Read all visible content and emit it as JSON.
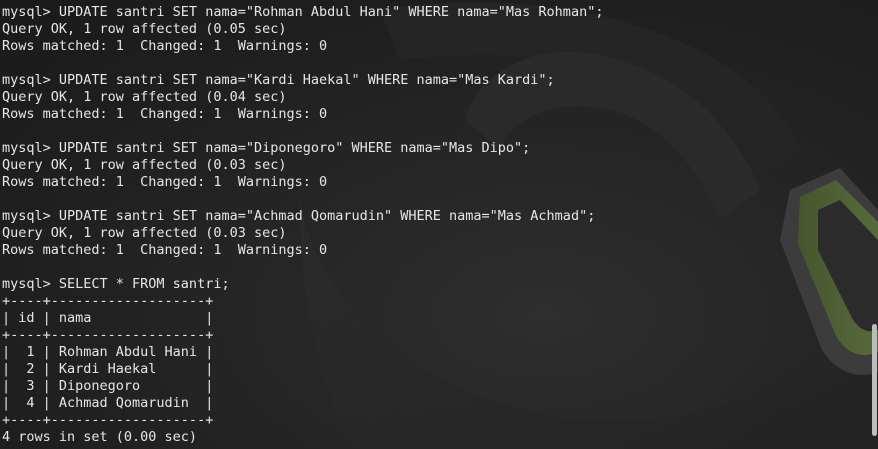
{
  "terminal": {
    "lines": [
      "mysql> UPDATE santri SET nama=\"Rohman Abdul Hani\" WHERE nama=\"Mas Rohman\";",
      "Query OK, 1 row affected (0.05 sec)",
      "Rows matched: 1  Changed: 1  Warnings: 0",
      "",
      "mysql> UPDATE santri SET nama=\"Kardi Haekal\" WHERE nama=\"Mas Kardi\";",
      "Query OK, 1 row affected (0.04 sec)",
      "Rows matched: 1  Changed: 1  Warnings: 0",
      "",
      "mysql> UPDATE santri SET nama=\"Diponegoro\" WHERE nama=\"Mas Dipo\";",
      "Query OK, 1 row affected (0.03 sec)",
      "Rows matched: 1  Changed: 1  Warnings: 0",
      "",
      "mysql> UPDATE santri SET nama=\"Achmad Qomarudin\" WHERE nama=\"Mas Achmad\";",
      "Query OK, 1 row affected (0.03 sec)",
      "Rows matched: 1  Changed: 1  Warnings: 0",
      "",
      "mysql> SELECT * FROM santri;",
      "+----+-------------------+",
      "| id | nama              |",
      "+----+-------------------+",
      "|  1 | Rohman Abdul Hani |",
      "|  2 | Kardi Haekal      |",
      "|  3 | Diponegoro        |",
      "|  4 | Achmad Qomarudin  |",
      "+----+-------------------+",
      "4 rows in set (0.00 sec)"
    ]
  },
  "scrollbar": {
    "position_fraction": 0.96,
    "visible_fraction": 0.25
  },
  "colors": {
    "text": "#e6e6e6",
    "background": "#1e1e1e",
    "accent": "#6f8f3a"
  }
}
